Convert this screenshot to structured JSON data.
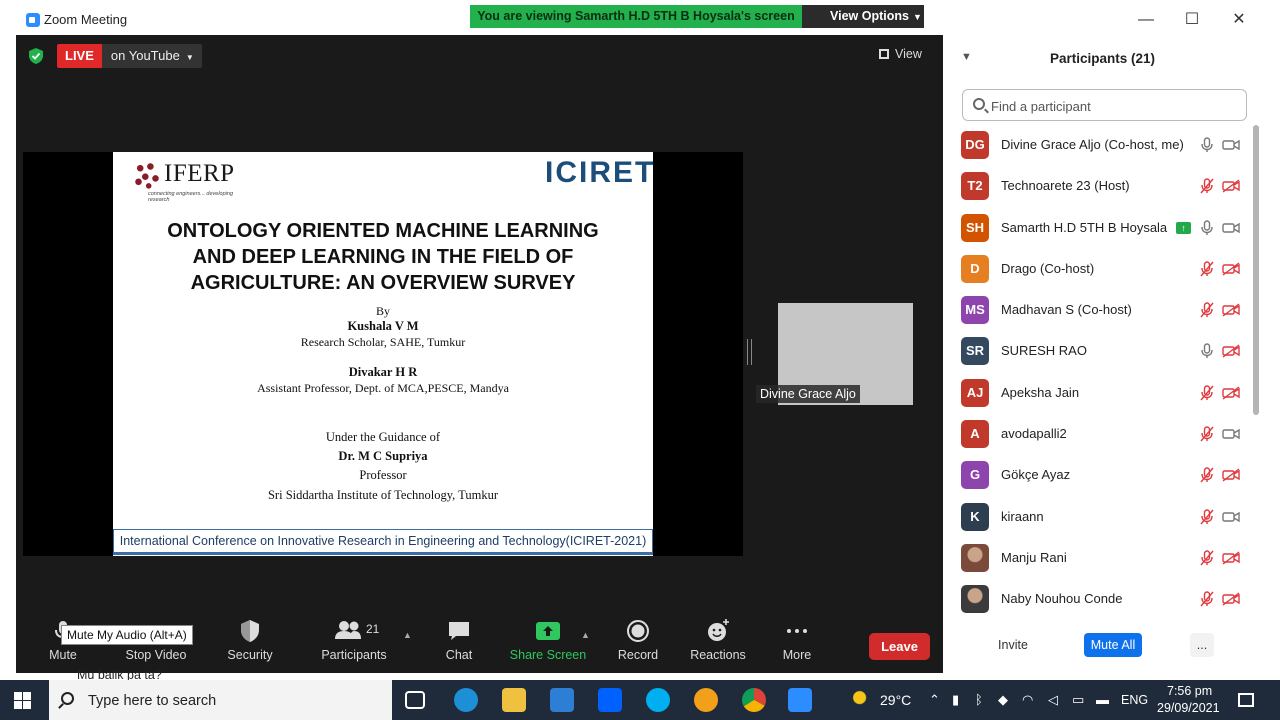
{
  "window": {
    "title": "Zoom Meeting",
    "banner": "You are viewing Samarth H.D 5TH B Hoysala's screen",
    "view_options": "View Options",
    "minimize": "—",
    "maximize": "☐",
    "close": "✕"
  },
  "stage": {
    "live_label": "LIVE",
    "live_platform": "on YouTube",
    "view_label": "View",
    "thumbnail_name": "Divine Grace Aljo",
    "tooltip": "Mute My Audio (Alt+A)"
  },
  "slide": {
    "logo_left": "IFERP",
    "logo_left_tagline": "connecting engineers... developing research",
    "logo_right": "ICIRET",
    "title_lines": [
      "ONTOLOGY ORIENTED MACHINE LEARNING",
      "AND DEEP LEARNING IN THE FIELD OF",
      "AGRICULTURE: AN OVERVIEW SURVEY"
    ],
    "by": "By",
    "author1": "Kushala V M",
    "author1_role": "Research Scholar, SAHE, Tumkur",
    "author2": "Divakar H R",
    "author2_role": "Assistant Professor, Dept. of MCA,PESCE, Mandya",
    "guidance": "Under the Guidance of",
    "guide": "Dr. M C Supriya",
    "guide_role": "Professor",
    "guide_institute": "Sri Siddartha Institute of Technology, Tumkur",
    "footer": "International Conference on Innovative Research in Engineering and Technology(ICIRET-2021)"
  },
  "toolbar": {
    "mute": "Mute",
    "stop_video": "Stop Video",
    "security": "Security",
    "participants": "Participants",
    "participants_count": "21",
    "chat": "Chat",
    "share_screen": "Share Screen",
    "record": "Record",
    "reactions": "Reactions",
    "more": "More",
    "leave": "Leave"
  },
  "panel": {
    "title": "Participants (21)",
    "search_placeholder": "Find a participant",
    "invite": "Invite",
    "mute_all": "Mute All",
    "more": "...",
    "participants": [
      {
        "initials": "DG",
        "name": "Divine Grace Aljo (Co-host, me)",
        "color": "#c0392b",
        "mic": "on",
        "cam": "on"
      },
      {
        "initials": "T2",
        "name": "Technoarete 23 (Host)",
        "color": "#c0392b",
        "mic": "off",
        "cam": "off"
      },
      {
        "initials": "SH",
        "name": "Samarth H.D 5TH B Hoysala",
        "color": "#d35400",
        "mic": "on",
        "cam": "on",
        "sharing": true
      },
      {
        "initials": "D",
        "name": "Drago (Co-host)",
        "color": "#e67e22",
        "mic": "off",
        "cam": "off"
      },
      {
        "initials": "MS",
        "name": "Madhavan S (Co-host)",
        "color": "#8e44ad",
        "mic": "off",
        "cam": "off"
      },
      {
        "initials": "SR",
        "name": "SURESH RAO",
        "color": "#34495e",
        "mic": "on",
        "cam": "off"
      },
      {
        "initials": "AJ",
        "name": "Apeksha Jain",
        "color": "#c0392b",
        "mic": "off",
        "cam": "off"
      },
      {
        "initials": "A",
        "name": "avodapalli2",
        "color": "#c0392b",
        "mic": "off",
        "cam": "on"
      },
      {
        "initials": "G",
        "name": "Gökçe Ayaz",
        "color": "#8e44ad",
        "mic": "off",
        "cam": "off"
      },
      {
        "initials": "K",
        "name": "kiraann",
        "color": "#2c3e50",
        "mic": "off",
        "cam": "on"
      },
      {
        "initials": "",
        "name": "Manju Rani",
        "color": "#7a4b3a",
        "mic": "off",
        "cam": "off",
        "photo": true
      },
      {
        "initials": "",
        "name": "Naby Nouhou Conde",
        "color": "#3b3b3b",
        "mic": "off",
        "cam": "off",
        "photo": true
      }
    ]
  },
  "taskbar": {
    "search_placeholder": "Type here to search",
    "temperature": "29°C",
    "language": "ENG",
    "time": "7:56 pm",
    "date": "29/09/2021",
    "behind_text": "Mu balik pa ta?"
  },
  "colors": {
    "accent": "#2D8CFF",
    "live_red": "#e02828",
    "leave_red": "#d22b2b",
    "share_green": "#30c75e",
    "muted_red": "#e0393e",
    "banner_green": "#22b14c"
  }
}
